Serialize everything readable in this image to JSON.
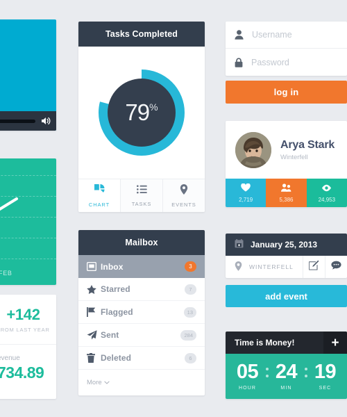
{
  "video": {
    "name": "video-player",
    "volume_icon": "volume-icon"
  },
  "trend": {
    "month_label": "FEB"
  },
  "stats": {
    "delta": "+142",
    "delta_caption": "FROM LAST YEAR",
    "revenue_label": "evenue",
    "revenue_value": "734.89"
  },
  "tasks": {
    "title": "Tasks Completed",
    "percent_value": "79",
    "percent_symbol": "%",
    "tabs": [
      {
        "label": "CHART",
        "icon": "pie-chart-icon",
        "active": true
      },
      {
        "label": "TASKS",
        "icon": "list-icon",
        "active": false
      },
      {
        "label": "EVENTS",
        "icon": "map-pin-icon",
        "active": false
      }
    ]
  },
  "mailbox": {
    "title": "Mailbox",
    "items": [
      {
        "label": "Inbox",
        "badge": "3",
        "icon": "inbox-icon",
        "active": true
      },
      {
        "label": "Starred",
        "badge": "7",
        "icon": "star-icon",
        "active": false
      },
      {
        "label": "Flagged",
        "badge": "13",
        "icon": "flag-icon",
        "active": false
      },
      {
        "label": "Sent",
        "badge": "284",
        "icon": "paper-plane-icon",
        "active": false
      },
      {
        "label": "Deleted",
        "badge": "6",
        "icon": "trash-icon",
        "active": false
      }
    ],
    "more_label": "More"
  },
  "login": {
    "username_placeholder": "Username",
    "password_placeholder": "Password",
    "username_icon": "user-icon",
    "password_icon": "lock-icon",
    "button_label": "log in"
  },
  "profile": {
    "name": "Arya Stark",
    "location": "Winterfell",
    "avatar_name": "avatar",
    "stats": [
      {
        "icon": "heart-icon",
        "value": "2,719",
        "color": "#29b8d8"
      },
      {
        "icon": "users-icon",
        "value": "5,386",
        "color": "#f1772d"
      },
      {
        "icon": "eye-icon",
        "value": "24,953",
        "color": "#1bbc9b"
      }
    ]
  },
  "event": {
    "date": "January 25, 2013",
    "calendar_icon": "calendar-icon",
    "location": "WINTERFELL",
    "location_icon": "map-pin-icon",
    "edit_icon": "edit-icon",
    "comment_icon": "comment-icon",
    "button_label": "add event"
  },
  "countdown": {
    "title": "Time is Money!",
    "add_label": "+",
    "units": [
      {
        "value": "05",
        "label": "HOUR"
      },
      {
        "value": "24",
        "label": "MIN"
      },
      {
        "value": "19",
        "label": "SEC"
      }
    ]
  },
  "colors": {
    "background": "#e9ebef",
    "dark": "#333e4d",
    "cyan": "#28b9d8",
    "orange": "#f1772d",
    "teal": "#1dbc9c",
    "countdown_green": "#27b79a"
  }
}
